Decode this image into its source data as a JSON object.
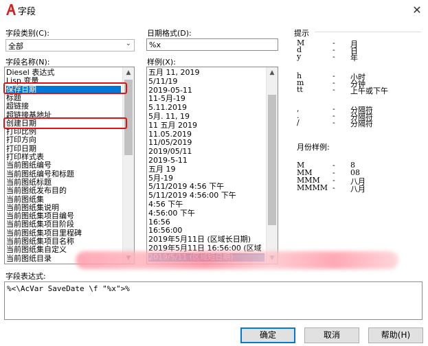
{
  "window": {
    "title": "字段",
    "close": "✕"
  },
  "category": {
    "label": "字段类别(C):",
    "value": "全部"
  },
  "fieldnames": {
    "label": "字段名称(N):",
    "items": [
      "Diesel 表达式",
      "Lisp 变量",
      "保存日期",
      "标题",
      "超链接",
      "超链接基地址",
      "创建日期",
      "打印比例",
      "打印方向",
      "打印日期",
      "打印样式表",
      "当前图纸编号",
      "当前图纸编号和标题",
      "当前图纸标题",
      "当前图纸发布目的",
      "当前图纸集",
      "当前图纸集说明",
      "当前图纸集项目编号",
      "当前图纸集项目阶段",
      "当前图纸集项目里程碑",
      "当前图纸集项目名称",
      "当前图纸集自定义",
      "当前图纸目录"
    ],
    "selected_index": 2
  },
  "dateformat": {
    "label": "日期格式(D):",
    "value": "%x"
  },
  "examples": {
    "label": "样例(X):",
    "items": [
      "五月 11, 2019",
      "5/11/19",
      "2019-05-11",
      "11-5月-19",
      "5.11.2019",
      "5月. 11, 19",
      "11 五月 2019",
      "11.05.2019",
      "11/05/2019",
      "2019/05/11",
      "2019-5-11",
      "五月 19",
      "5月-19",
      "5/11/2019 4:56 下午",
      "5/11/2019 4:56:00 下午",
      "4:56 下午",
      "4:56:00 下午",
      "16:56",
      "16:56:00",
      "2019年5月11日 (区域长日期)",
      "2019年5月11日 16:56:00 (区域",
      "2019/5/11 (区域短日期)"
    ],
    "selected_index": 21
  },
  "hints": {
    "label": "提示",
    "rows": [
      {
        "k": "M",
        "d": "-",
        "v": "月"
      },
      {
        "k": "d",
        "d": "-",
        "v": "日"
      },
      {
        "k": "y",
        "d": "-",
        "v": "年"
      },
      {
        "k": "h",
        "d": "-",
        "v": "小时"
      },
      {
        "k": "m",
        "d": "-",
        "v": "分钟"
      },
      {
        "k": "tt",
        "d": "-",
        "v": "上午或下午"
      },
      {
        "k": ",",
        "d": "-",
        "v": "分隔符"
      },
      {
        "k": ".",
        "d": "-",
        "v": "分隔符"
      },
      {
        "k": "/",
        "d": "-",
        "v": "分隔符"
      }
    ],
    "month_label": "月份样例:",
    "month_rows": [
      {
        "k": "M",
        "d": "-",
        "v": "8"
      },
      {
        "k": "MM",
        "d": "-",
        "v": "08"
      },
      {
        "k": "MMM",
        "d": "-",
        "v": "八月"
      },
      {
        "k": "MMMM",
        "d": "-",
        "v": "八月"
      }
    ]
  },
  "expression": {
    "label": "字段表达式:",
    "value": "%<\\AcVar SaveDate \\f \"%x\">%"
  },
  "buttons": {
    "ok": "确定",
    "cancel": "取消",
    "help": "帮助(H)"
  },
  "colors": {
    "selection": "#0078d7",
    "annotation": "#e01010",
    "title_icon": "#d81e1e"
  }
}
